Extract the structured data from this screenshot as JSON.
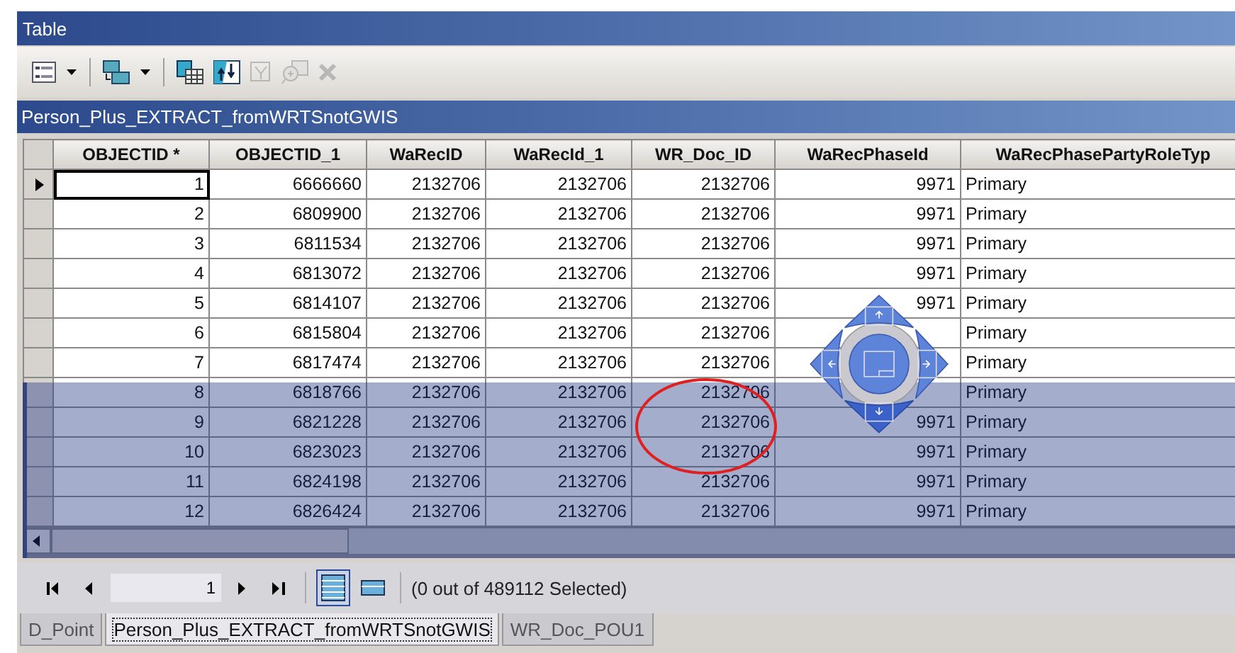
{
  "window": {
    "title": "Table"
  },
  "toolbar": [
    {
      "kind": "table-options",
      "dropdown": true,
      "disabled": false
    },
    {
      "kind": "related-tables",
      "dropdown": true,
      "disabled": false
    },
    {
      "kind": "select-by-attributes",
      "dropdown": false,
      "disabled": false
    },
    {
      "kind": "switch-selection",
      "dropdown": false,
      "disabled": false
    },
    {
      "kind": "clear-selection",
      "dropdown": false,
      "disabled": true
    },
    {
      "kind": "zoom-selected",
      "dropdown": false,
      "disabled": true
    },
    {
      "kind": "delete",
      "dropdown": false,
      "disabled": true
    }
  ],
  "table": {
    "name": "Person_Plus_EXTRACT_fromWRTSnotGWIS",
    "columns": [
      "OBJECTID *",
      "OBJECTID_1",
      "WaRecID",
      "WaRecId_1",
      "WR_Doc_ID",
      "WaRecPhaseId",
      "WaRecPhasePartyRoleTyp"
    ],
    "rows": [
      {
        "current": true,
        "cells": [
          "1",
          "6666660",
          "2132706",
          "2132706",
          "2132706",
          "9971",
          "Primary"
        ]
      },
      {
        "current": false,
        "cells": [
          "2",
          "6809900",
          "2132706",
          "2132706",
          "2132706",
          "9971",
          "Primary"
        ]
      },
      {
        "current": false,
        "cells": [
          "3",
          "6811534",
          "2132706",
          "2132706",
          "2132706",
          "9971",
          "Primary"
        ]
      },
      {
        "current": false,
        "cells": [
          "4",
          "6813072",
          "2132706",
          "2132706",
          "2132706",
          "9971",
          "Primary"
        ]
      },
      {
        "current": false,
        "cells": [
          "5",
          "6814107",
          "2132706",
          "2132706",
          "2132706",
          "9971",
          "Primary"
        ]
      },
      {
        "current": false,
        "cells": [
          "6",
          "6815804",
          "2132706",
          "2132706",
          "2132706",
          null,
          "Primary"
        ]
      },
      {
        "current": false,
        "cells": [
          "7",
          "6817474",
          "2132706",
          "2132706",
          "2132706",
          null,
          "Primary"
        ]
      },
      {
        "current": false,
        "cells": [
          "8",
          "6818766",
          "2132706",
          "2132706",
          "2132706",
          null,
          "Primary"
        ]
      },
      {
        "current": false,
        "cells": [
          "9",
          "6821228",
          "2132706",
          "2132706",
          "2132706",
          "9971",
          "Primary"
        ]
      },
      {
        "current": false,
        "cells": [
          "10",
          "6823023",
          "2132706",
          "2132706",
          "2132706",
          "9971",
          "Primary"
        ]
      },
      {
        "current": false,
        "cells": [
          "11",
          "6824198",
          "2132706",
          "2132706",
          "2132706",
          "9971",
          "Primary"
        ]
      },
      {
        "current": false,
        "cells": [
          "12",
          "6826424",
          "2132706",
          "2132706",
          "2132706",
          "9971",
          "Primary"
        ]
      }
    ]
  },
  "dock_preview": {
    "visible": true
  },
  "annotation_circle": {
    "visible": true
  },
  "navigator": {
    "record": "1",
    "views": [
      {
        "kind": "all",
        "selected": true
      },
      {
        "kind": "selected-only",
        "selected": false
      }
    ],
    "status": "(0 out of 489112 Selected)"
  },
  "tabs": [
    {
      "label": "D_Point",
      "selected": false
    },
    {
      "label": "Person_Plus_EXTRACT_fromWRTSnotGWIS",
      "selected": true
    },
    {
      "label": "WR_Doc_POU1",
      "selected": false
    }
  ]
}
